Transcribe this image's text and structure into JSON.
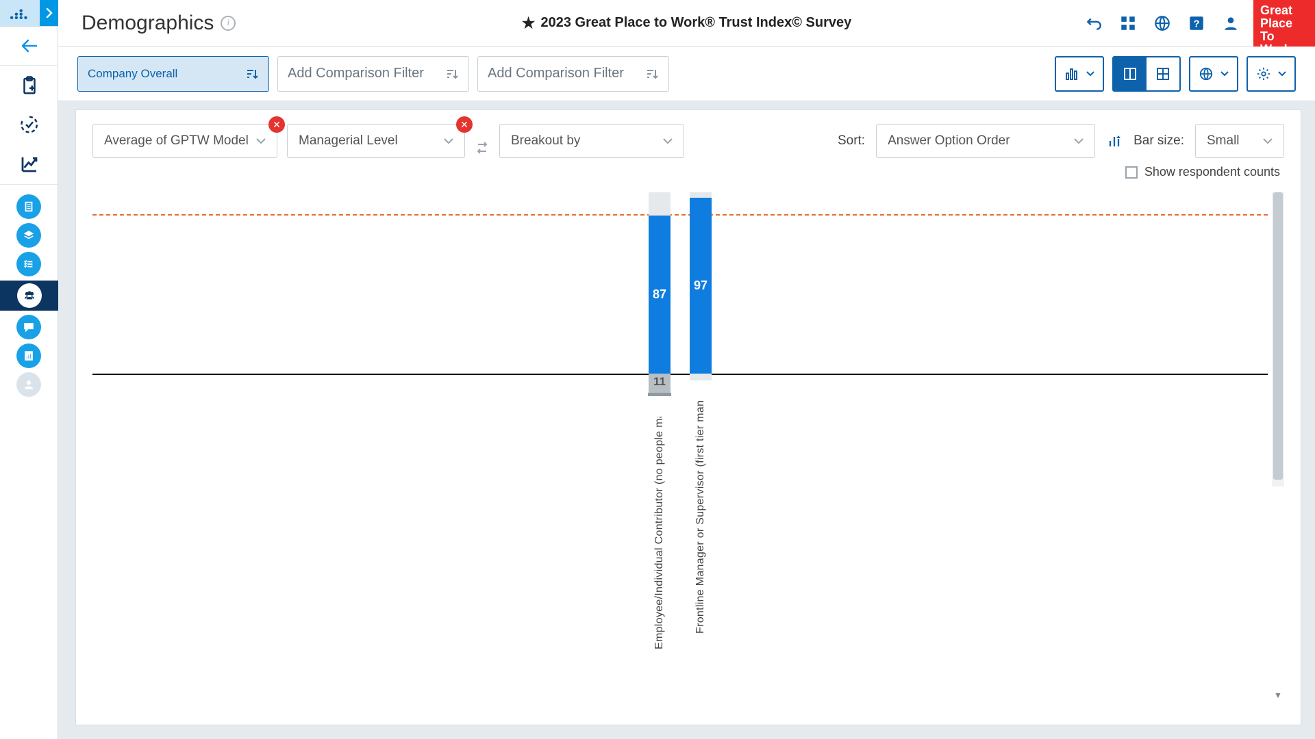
{
  "header": {
    "title": "Demographics",
    "survey_name": "2023 Great Place to Work® Trust Index© Survey",
    "logo_lines": [
      "Great",
      "Place",
      "To",
      "Work"
    ]
  },
  "filters": {
    "company_scope": "Company Overall",
    "add_comparison_placeholder": "Add Comparison Filter"
  },
  "controls": {
    "metric": "Average of GPTW Model",
    "dimension": "Managerial Level",
    "breakout": "Breakout by",
    "sort_label": "Sort:",
    "sort_value": "Answer Option Order",
    "bar_size_label": "Bar size:",
    "bar_size_value": "Small",
    "show_counts_label": "Show respondent counts"
  },
  "chart_data": {
    "type": "bar",
    "categories": [
      "Employee/Individual Contributor (no people manc",
      "Frontline Manager or Supervisor (first tier manag"
    ],
    "values": [
      87,
      97
    ],
    "negatives": [
      11,
      null
    ],
    "benchmark": 93,
    "ylim": [
      0,
      100
    ],
    "title": "",
    "xlabel": "",
    "ylabel": ""
  }
}
